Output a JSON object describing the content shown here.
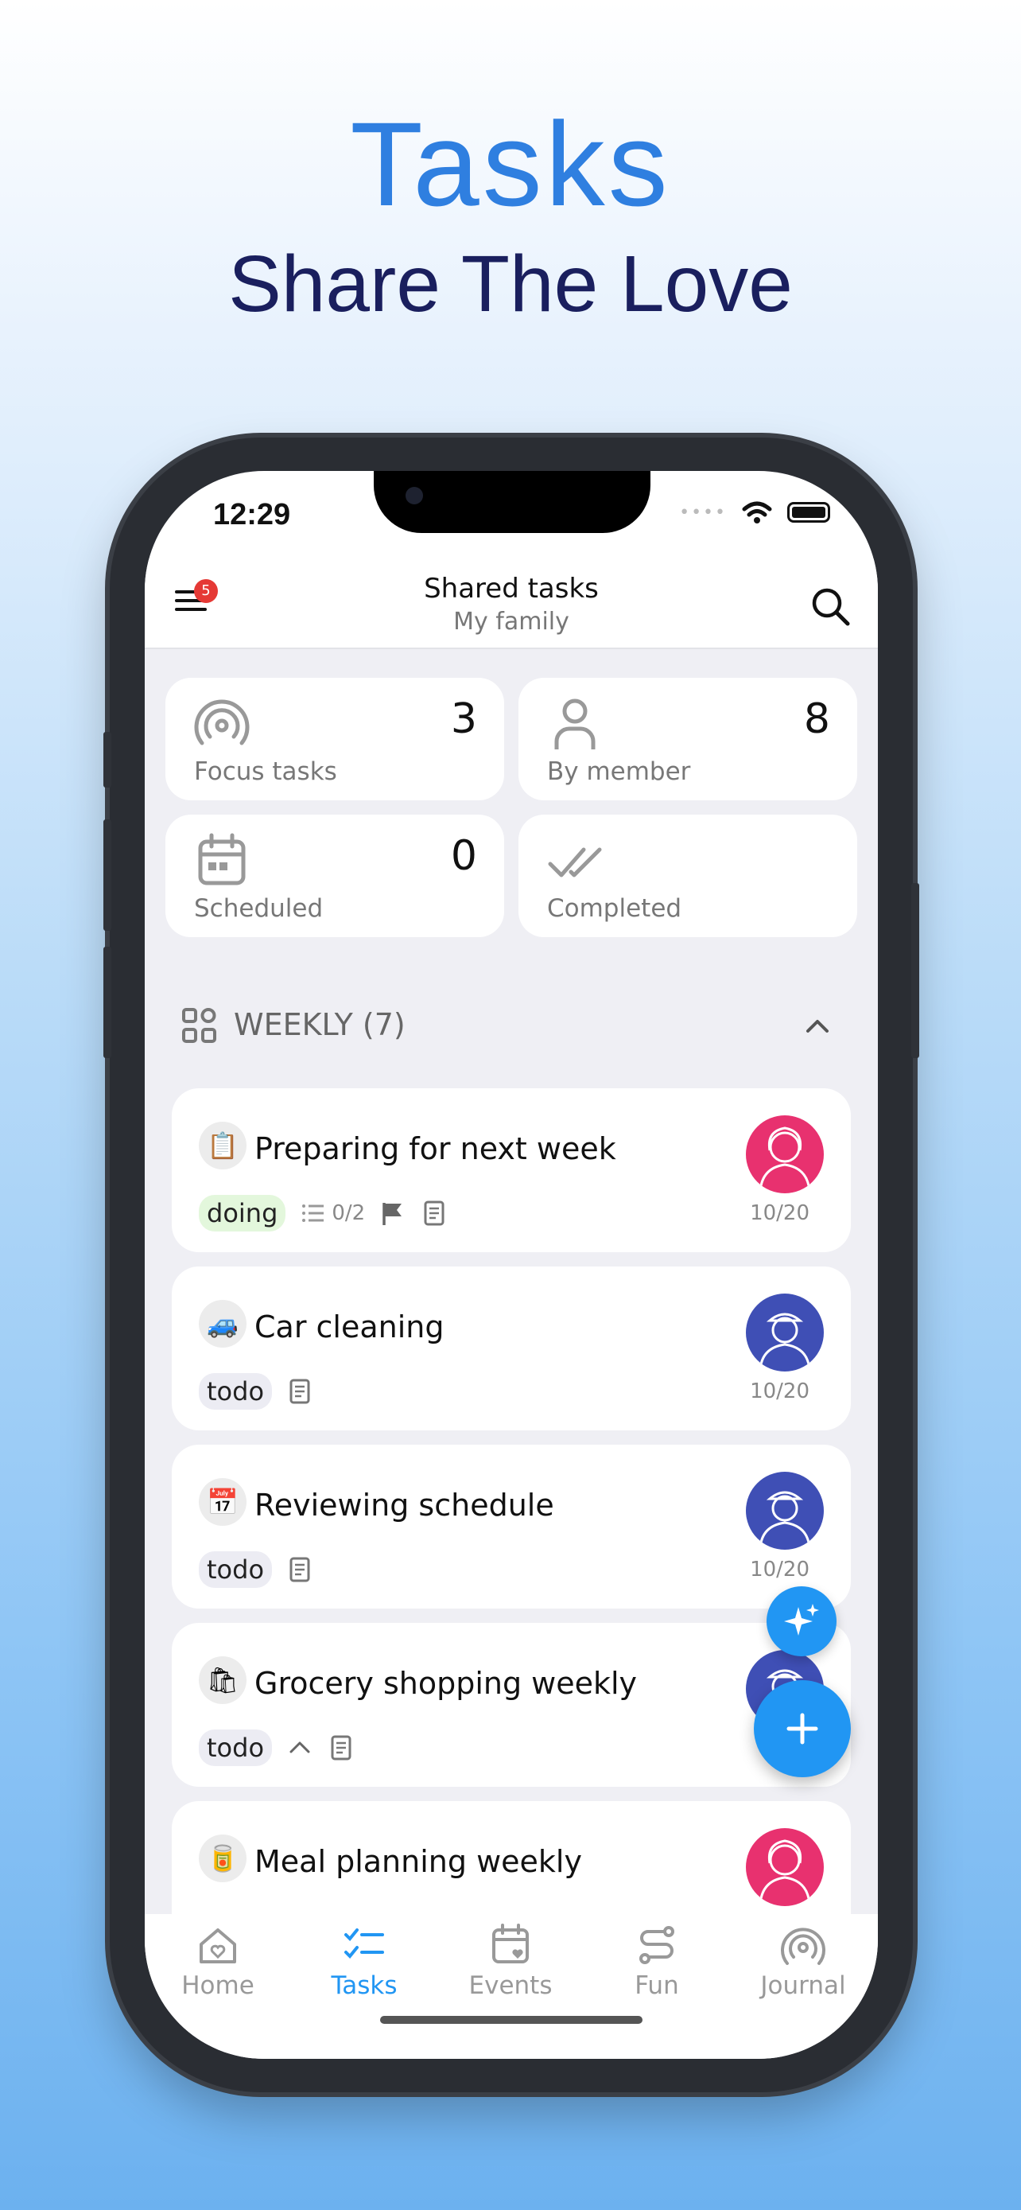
{
  "promo": {
    "title": "Tasks",
    "subtitle": "Share The Love"
  },
  "status_bar": {
    "time": "12:29"
  },
  "header": {
    "menu_badge": "5",
    "title": "Shared tasks",
    "subtitle": "My family"
  },
  "stats": [
    {
      "label": "Focus tasks",
      "count": "3",
      "icon": "focus-icon"
    },
    {
      "label": "By member",
      "count": "8",
      "icon": "person-icon"
    },
    {
      "label": "Scheduled",
      "count": "0",
      "icon": "calendar-icon"
    },
    {
      "label": "Completed",
      "count": "",
      "icon": "double-check-icon"
    }
  ],
  "section": {
    "title": "WEEKLY (7)"
  },
  "tasks": [
    {
      "emoji": "📋",
      "title": "Preparing for next week",
      "status": "doing",
      "subtasks": "0/2",
      "date": "10/20",
      "avatar": "pink"
    },
    {
      "emoji": "🚙",
      "title": "Car cleaning",
      "status": "todo",
      "date": "10/20",
      "avatar": "blue"
    },
    {
      "emoji": "📅",
      "title": "Reviewing schedule",
      "status": "todo",
      "date": "10/20",
      "avatar": "blue"
    },
    {
      "emoji": "🛍",
      "title": "Grocery shopping weekly",
      "status": "todo",
      "date": "",
      "avatar": "blue"
    },
    {
      "emoji": "🥫",
      "title": "Meal planning weekly",
      "status": "",
      "date": "",
      "avatar": "pink"
    }
  ],
  "nav": [
    {
      "label": "Home",
      "icon": "home-heart-icon"
    },
    {
      "label": "Tasks",
      "icon": "tasks-icon",
      "active": true
    },
    {
      "label": "Events",
      "icon": "calendar-heart-icon"
    },
    {
      "label": "Fun",
      "icon": "route-icon"
    },
    {
      "label": "Journal",
      "icon": "journal-icon"
    }
  ],
  "colors": {
    "accent": "#2196f3",
    "title_blue": "#2f7fe0",
    "subtitle_navy": "#1a1f5e",
    "pink_avatar": "#e8316f",
    "blue_avatar": "#3f4fb5",
    "doing_bg": "#e3f7dc"
  }
}
